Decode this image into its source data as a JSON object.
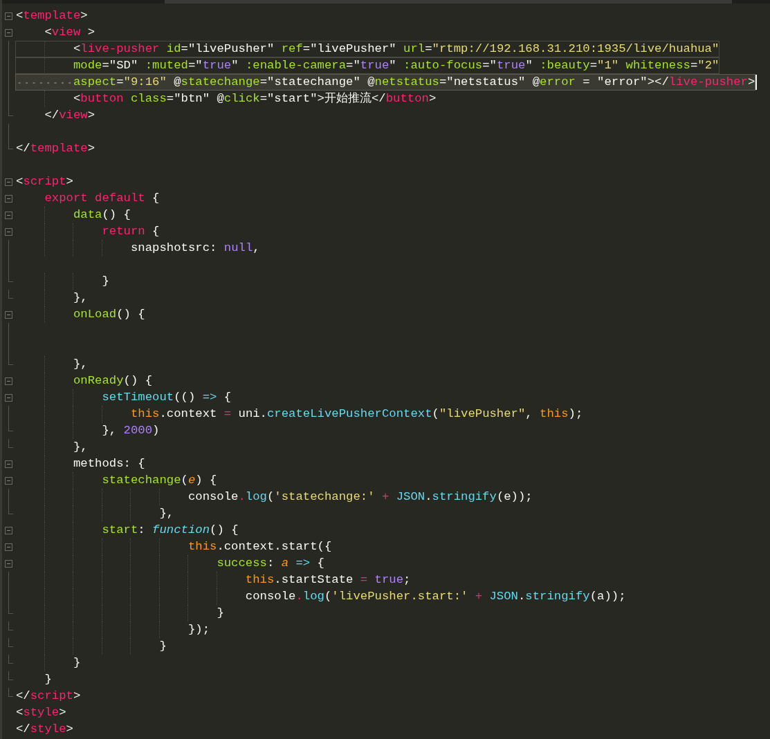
{
  "editor": {
    "lines": [
      {
        "kind": "fold",
        "marked": false,
        "selected": false,
        "tokens": [
          {
            "kind": "plain",
            "text": "<"
          },
          {
            "kind": "tag",
            "text": "template"
          },
          {
            "kind": "plain",
            "text": ">"
          }
        ]
      },
      {
        "kind": "fold",
        "marked": false,
        "selected": false,
        "tokens": [
          {
            "kind": "plain",
            "text": "    <"
          },
          {
            "kind": "tag",
            "text": "view"
          },
          {
            "kind": "plain",
            "text": " >"
          }
        ]
      },
      {
        "kind": "body",
        "marked": true,
        "selected": false,
        "tokens": [
          {
            "kind": "plain",
            "text": "        <"
          },
          {
            "kind": "tag",
            "text": "live-pusher "
          },
          {
            "kind": "attr",
            "text": "id"
          },
          {
            "kind": "plain",
            "text": "=\"livePusher\" "
          },
          {
            "kind": "attr",
            "text": "ref"
          },
          {
            "kind": "plain",
            "text": "=\"livePusher\" "
          },
          {
            "kind": "attr",
            "text": "url"
          },
          {
            "kind": "plain",
            "text": "="
          },
          {
            "kind": "string",
            "text": "\"rtmp://192.168.31.210:1935/live/huahua\""
          }
        ]
      },
      {
        "kind": "body",
        "marked": true,
        "selected": false,
        "tokens": [
          {
            "kind": "attr",
            "text": "        mode"
          },
          {
            "kind": "plain",
            "text": "=\"SD\" "
          },
          {
            "kind": "attr",
            "text": ":muted"
          },
          {
            "kind": "plain",
            "text": "=\""
          },
          {
            "kind": "constant",
            "text": "true"
          },
          {
            "kind": "plain",
            "text": "\" "
          },
          {
            "kind": "attr",
            "text": ":enable-camera"
          },
          {
            "kind": "plain",
            "text": "=\""
          },
          {
            "kind": "constant",
            "text": "true"
          },
          {
            "kind": "plain",
            "text": "\" "
          },
          {
            "kind": "attr",
            "text": ":auto-focus"
          },
          {
            "kind": "plain",
            "text": "=\""
          },
          {
            "kind": "constant",
            "text": "true"
          },
          {
            "kind": "plain",
            "text": "\" "
          },
          {
            "kind": "attr",
            "text": ":beauty"
          },
          {
            "kind": "plain",
            "text": "="
          },
          {
            "kind": "string",
            "text": "\"1\" "
          },
          {
            "kind": "attr",
            "text": "whiteness"
          },
          {
            "kind": "plain",
            "text": "="
          },
          {
            "kind": "string",
            "text": "\"2\""
          }
        ]
      },
      {
        "kind": "body",
        "marked": false,
        "selected": true,
        "tokens": [
          {
            "kind": "attr",
            "text": "        aspect"
          },
          {
            "kind": "plain",
            "text": "="
          },
          {
            "kind": "string",
            "text": "\"9:16\""
          },
          {
            "kind": "plain",
            "text": " @"
          },
          {
            "kind": "attr",
            "text": "statechange"
          },
          {
            "kind": "plain",
            "text": "=\"statechange\" @"
          },
          {
            "kind": "attr",
            "text": "netstatus"
          },
          {
            "kind": "plain",
            "text": "=\"netstatus\" @"
          },
          {
            "kind": "attr",
            "text": "error"
          },
          {
            "kind": "plain",
            "text": " = \"error\"></"
          },
          {
            "kind": "tag",
            "text": "live-pusher"
          },
          {
            "kind": "plain",
            "text": ">"
          }
        ]
      },
      {
        "kind": "body",
        "marked": false,
        "selected": false,
        "tokens": [
          {
            "kind": "plain",
            "text": "        <"
          },
          {
            "kind": "tag",
            "text": "button "
          },
          {
            "kind": "attr",
            "text": "class"
          },
          {
            "kind": "plain",
            "text": "=\"btn\" @"
          },
          {
            "kind": "attr",
            "text": "click"
          },
          {
            "kind": "plain",
            "text": "=\"start\">开始推流</"
          },
          {
            "kind": "tag",
            "text": "button"
          },
          {
            "kind": "plain",
            "text": ">"
          }
        ]
      },
      {
        "kind": "fold_end",
        "marked": false,
        "selected": false,
        "tokens": [
          {
            "kind": "plain",
            "text": "    </"
          },
          {
            "kind": "tag",
            "text": "view"
          },
          {
            "kind": "plain",
            "text": ">"
          }
        ]
      },
      {
        "kind": "body",
        "marked": false,
        "selected": false
      },
      {
        "kind": "fold_end",
        "marked": false,
        "selected": false,
        "tokens": [
          {
            "kind": "plain",
            "text": "</"
          },
          {
            "kind": "tag",
            "text": "template"
          },
          {
            "kind": "plain",
            "text": ">"
          }
        ]
      },
      {
        "kind": "plain",
        "marked": false,
        "selected": false
      },
      {
        "kind": "fold",
        "marked": false,
        "selected": false,
        "tokens": [
          {
            "kind": "plain",
            "text": "<"
          },
          {
            "kind": "tag",
            "text": "script"
          },
          {
            "kind": "plain",
            "text": ">"
          }
        ]
      },
      {
        "kind": "fold",
        "marked": false,
        "selected": false,
        "tokens": [
          {
            "kind": "tag",
            "text": "    export default "
          },
          {
            "kind": "plain",
            "text": "{"
          }
        ]
      },
      {
        "kind": "fold",
        "marked": false,
        "selected": false,
        "tokens": [
          {
            "kind": "attr",
            "text": "        data"
          },
          {
            "kind": "plain",
            "text": "() {"
          }
        ]
      },
      {
        "kind": "fold",
        "marked": false,
        "selected": false,
        "tokens": [
          {
            "kind": "tag",
            "text": "            return "
          },
          {
            "kind": "plain",
            "text": "{"
          }
        ]
      },
      {
        "kind": "body",
        "marked": false,
        "selected": false,
        "tokens": [
          {
            "kind": "plain",
            "text": "                snapshotsrc: "
          },
          {
            "kind": "constant",
            "text": "null"
          },
          {
            "kind": "plain",
            "text": ","
          }
        ]
      },
      {
        "kind": "body",
        "marked": false,
        "selected": false
      },
      {
        "kind": "fold_end",
        "marked": false,
        "selected": false,
        "tokens": [
          {
            "kind": "plain",
            "text": "            }"
          }
        ]
      },
      {
        "kind": "fold_end",
        "marked": false,
        "selected": false,
        "tokens": [
          {
            "kind": "plain",
            "text": "        },"
          }
        ]
      },
      {
        "kind": "fold",
        "marked": false,
        "selected": false,
        "tokens": [
          {
            "kind": "attr",
            "text": "        onLoad"
          },
          {
            "kind": "plain",
            "text": "() {"
          }
        ]
      },
      {
        "kind": "body",
        "marked": false,
        "selected": false
      },
      {
        "kind": "body",
        "marked": false,
        "selected": false
      },
      {
        "kind": "fold_end",
        "marked": false,
        "selected": false,
        "tokens": [
          {
            "kind": "plain",
            "text": "        },"
          }
        ]
      },
      {
        "kind": "fold",
        "marked": false,
        "selected": false,
        "tokens": [
          {
            "kind": "attr",
            "text": "        onReady"
          },
          {
            "kind": "plain",
            "text": "() {"
          }
        ]
      },
      {
        "kind": "fold",
        "marked": false,
        "selected": false,
        "tokens": [
          {
            "kind": "support",
            "text": "            setTimeout"
          },
          {
            "kind": "plain",
            "text": "(() "
          },
          {
            "kind": "support",
            "text": "=>"
          },
          {
            "kind": "plain",
            "text": " {"
          }
        ]
      },
      {
        "kind": "body",
        "marked": false,
        "selected": false,
        "tokens": [
          {
            "kind": "this",
            "text": "                this"
          },
          {
            "kind": "plain",
            "text": ".context "
          },
          {
            "kind": "tag",
            "text": "="
          },
          {
            "kind": "plain",
            "text": " uni."
          },
          {
            "kind": "support",
            "text": "createLivePusherContext"
          },
          {
            "kind": "plain",
            "text": "("
          },
          {
            "kind": "string",
            "text": "\"livePusher\""
          },
          {
            "kind": "plain",
            "text": ", "
          },
          {
            "kind": "this",
            "text": "this"
          },
          {
            "kind": "plain",
            "text": ");"
          }
        ]
      },
      {
        "kind": "fold_end",
        "marked": false,
        "selected": false,
        "tokens": [
          {
            "kind": "plain",
            "text": "            }, "
          },
          {
            "kind": "constant",
            "text": "2000"
          },
          {
            "kind": "plain",
            "text": ")"
          }
        ]
      },
      {
        "kind": "fold_end",
        "marked": false,
        "selected": false,
        "tokens": [
          {
            "kind": "plain",
            "text": "        },"
          }
        ]
      },
      {
        "kind": "fold",
        "marked": false,
        "selected": false,
        "tokens": [
          {
            "kind": "plain",
            "text": "        methods: {"
          }
        ]
      },
      {
        "kind": "fold",
        "marked": false,
        "selected": false,
        "tokens": [
          {
            "kind": "attr",
            "text": "            statechange"
          },
          {
            "kind": "plain",
            "text": "("
          },
          {
            "kind": "param",
            "text": "e"
          },
          {
            "kind": "plain",
            "text": ") {"
          }
        ]
      },
      {
        "kind": "body",
        "marked": false,
        "selected": false,
        "tokens": [
          {
            "kind": "plain",
            "text": "                        console"
          },
          {
            "kind": "tag",
            "text": "."
          },
          {
            "kind": "support",
            "text": "log"
          },
          {
            "kind": "plain",
            "text": "("
          },
          {
            "kind": "string",
            "text": "'statechange:' "
          },
          {
            "kind": "tag",
            "text": "+ "
          },
          {
            "kind": "support",
            "text": "JSON"
          },
          {
            "kind": "plain",
            "text": "."
          },
          {
            "kind": "support",
            "text": "stringify"
          },
          {
            "kind": "plain",
            "text": "(e));"
          }
        ]
      },
      {
        "kind": "fold_end",
        "marked": false,
        "selected": false,
        "tokens": [
          {
            "kind": "plain",
            "text": "                    },"
          }
        ]
      },
      {
        "kind": "fold",
        "marked": false,
        "selected": false,
        "tokens": [
          {
            "kind": "attr",
            "text": "            start"
          },
          {
            "kind": "plain",
            "text": ": "
          },
          {
            "kind": "storage",
            "text": "function"
          },
          {
            "kind": "plain",
            "text": "() {"
          }
        ]
      },
      {
        "kind": "fold",
        "marked": false,
        "selected": false,
        "tokens": [
          {
            "kind": "this",
            "text": "                        this"
          },
          {
            "kind": "plain",
            "text": ".context.start({"
          }
        ]
      },
      {
        "kind": "fold",
        "marked": false,
        "selected": false,
        "tokens": [
          {
            "kind": "attr",
            "text": "                            success"
          },
          {
            "kind": "plain",
            "text": ": "
          },
          {
            "kind": "param",
            "text": "a "
          },
          {
            "kind": "support",
            "text": "=>"
          },
          {
            "kind": "plain",
            "text": " {"
          }
        ]
      },
      {
        "kind": "body",
        "marked": false,
        "selected": false,
        "tokens": [
          {
            "kind": "this",
            "text": "                                this"
          },
          {
            "kind": "plain",
            "text": ".startState "
          },
          {
            "kind": "tag",
            "text": "= "
          },
          {
            "kind": "constant",
            "text": "true"
          },
          {
            "kind": "plain",
            "text": ";"
          }
        ]
      },
      {
        "kind": "body",
        "marked": false,
        "selected": false,
        "tokens": [
          {
            "kind": "plain",
            "text": "                                console"
          },
          {
            "kind": "tag",
            "text": "."
          },
          {
            "kind": "support",
            "text": "log"
          },
          {
            "kind": "plain",
            "text": "("
          },
          {
            "kind": "string",
            "text": "'livePusher.start:' "
          },
          {
            "kind": "tag",
            "text": "+ "
          },
          {
            "kind": "support",
            "text": "JSON"
          },
          {
            "kind": "plain",
            "text": "."
          },
          {
            "kind": "support",
            "text": "stringify"
          },
          {
            "kind": "plain",
            "text": "(a));"
          }
        ]
      },
      {
        "kind": "fold_end",
        "marked": false,
        "selected": false,
        "tokens": [
          {
            "kind": "plain",
            "text": "                            }"
          }
        ]
      },
      {
        "kind": "fold_end",
        "marked": false,
        "selected": false,
        "tokens": [
          {
            "kind": "plain",
            "text": "                        });"
          }
        ]
      },
      {
        "kind": "fold_end",
        "marked": false,
        "selected": false,
        "tokens": [
          {
            "kind": "plain",
            "text": "                    }"
          }
        ]
      },
      {
        "kind": "fold_end",
        "marked": false,
        "selected": false,
        "tokens": [
          {
            "kind": "plain",
            "text": "        }"
          }
        ]
      },
      {
        "kind": "fold_end",
        "marked": false,
        "selected": false,
        "tokens": [
          {
            "kind": "plain",
            "text": "    }"
          }
        ]
      },
      {
        "kind": "fold_end",
        "marked": false,
        "selected": false,
        "tokens": [
          {
            "kind": "plain",
            "text": "</"
          },
          {
            "kind": "tag",
            "text": "script"
          },
          {
            "kind": "plain",
            "text": ">"
          }
        ]
      },
      {
        "kind": "plain",
        "marked": false,
        "selected": false,
        "tokens": [
          {
            "kind": "plain",
            "text": "<"
          },
          {
            "kind": "tag",
            "text": "style"
          },
          {
            "kind": "plain",
            "text": ">"
          }
        ]
      },
      {
        "kind": "plain",
        "marked": false,
        "selected": false,
        "tokens": [
          {
            "kind": "plain",
            "text": "</"
          },
          {
            "kind": "tag",
            "text": "style"
          },
          {
            "kind": "plain",
            "text": ">"
          }
        ]
      }
    ]
  }
}
